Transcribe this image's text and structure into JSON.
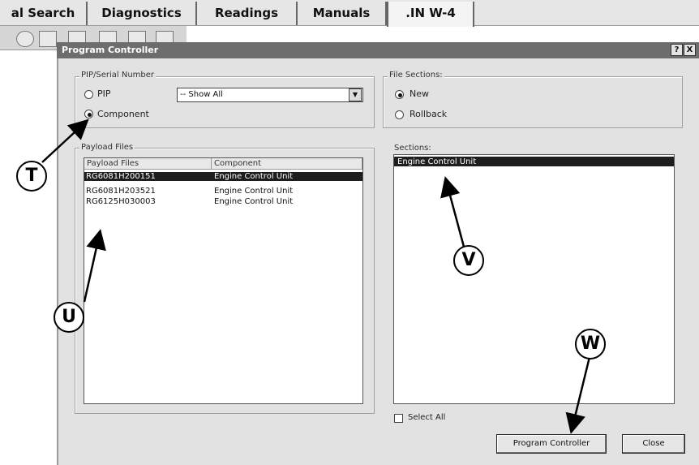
{
  "tabs": [
    {
      "label": "al Search"
    },
    {
      "label": "Diagnostics"
    },
    {
      "label": "Readings"
    },
    {
      "label": "Manuals"
    },
    {
      "label": ".IN W-4"
    }
  ],
  "dialog": {
    "title": "Program Controller",
    "help_label": "?",
    "close_label": "X"
  },
  "pip_group": {
    "label": "PIP/Serial Number",
    "radio_pip": "PIP",
    "radio_component": "Component",
    "selected": "Component",
    "dropdown_value": "-- Show All"
  },
  "payload_group": {
    "label": "Payload Files",
    "columns": [
      "Payload Files",
      "Component"
    ],
    "rows": [
      {
        "file": "RG6081H200151",
        "component": "Engine Control Unit",
        "selected": true
      },
      {
        "file": "RG6081H203521",
        "component": "Engine Control Unit",
        "selected": false
      },
      {
        "file": "RG6125H030003",
        "component": "Engine Control Unit",
        "selected": false
      }
    ]
  },
  "file_sections": {
    "label": "File Sections:",
    "radio_new": "New",
    "radio_rollback": "Rollback",
    "selected": "New"
  },
  "sections": {
    "label": "Sections:",
    "items": [
      {
        "label": "Engine Control Unit",
        "selected": true
      }
    ],
    "select_all_label": "Select All",
    "select_all_checked": false
  },
  "buttons": {
    "program_controller": "Program Controller",
    "close": "Close"
  },
  "callouts": {
    "t": "T",
    "u": "U",
    "v": "V",
    "w": "W"
  }
}
